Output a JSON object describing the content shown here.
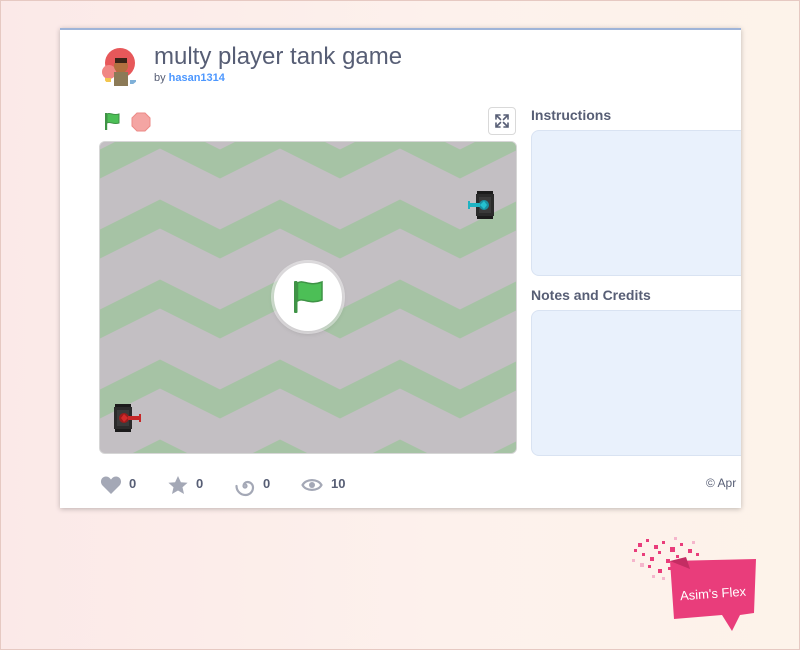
{
  "project": {
    "title": "multy player tank game",
    "by_label": "by",
    "author": "hasan1314"
  },
  "controls": {
    "green_flag_icon": "green-flag-icon",
    "stop_icon": "stop-sign-icon",
    "fullscreen_icon": "fullscreen-icon"
  },
  "stage": {
    "background_colors": [
      "#c3bfc3",
      "#a6c3a5"
    ],
    "overlay_icon": "green-flag-icon",
    "sprites": [
      "blue-tank",
      "red-tank"
    ]
  },
  "sidebar": {
    "instructions_heading": "Instructions",
    "notes_heading": "Notes and Credits"
  },
  "stats": {
    "loves": "0",
    "favorites": "0",
    "remixes": "0",
    "views": "10"
  },
  "footer": {
    "copyright": "© Apr"
  },
  "watermark": {
    "text": "Asim's Flex",
    "color": "#e93d7b"
  },
  "colors": {
    "accent": "#4c97ff",
    "text": "#575e75",
    "flag_green": "#4cbf56",
    "stop_red": "#ec5959"
  }
}
